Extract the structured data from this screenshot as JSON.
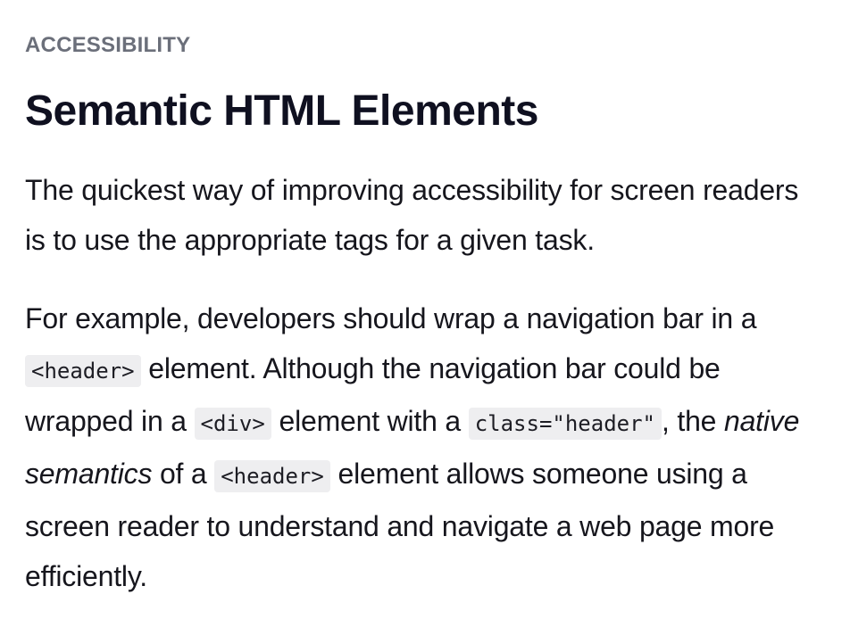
{
  "eyebrow": "ACCESSIBILITY",
  "title": "Semantic HTML Elements",
  "paragraph_1": "The quickest way of improving accessibility for screen readers is to use the appropriate tags for a given task.",
  "paragraph_2": {
    "t1": "For example, developers should wrap a navigation bar in a ",
    "code1": "<header>",
    "t2": " element. Although the navigation bar could be wrapped in a ",
    "code2": "<div>",
    "t3": " element with a ",
    "code3": "class=\"header\"",
    "t4": ", the ",
    "em1": "native semantics",
    "t5": " of a ",
    "code4": "<header>",
    "t6": " element allows someone using a screen reader to understand and navigate a web page more efficiently."
  },
  "colors": {
    "eyebrow": "#6b6f7a",
    "title": "#0f1020",
    "body": "#16161d",
    "code_bg": "#eeeef0"
  }
}
